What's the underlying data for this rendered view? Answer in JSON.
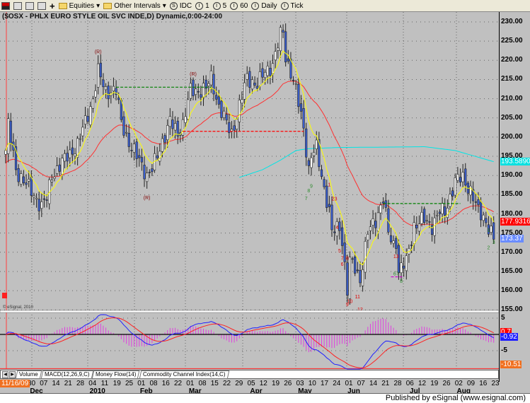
{
  "toolbar": {
    "items": [
      "Equities",
      "Other Intervals",
      "IDC",
      "1",
      "5",
      "60",
      "Daily",
      "Tick"
    ]
  },
  "chart_title": "($OSX - PHLX EURO STYLE OIL SVC INDE,D) Dynamic,0:00-24:00",
  "copyright": "© eSignal, 2010",
  "tabs": [
    "Volume",
    "MACD(12,26,9,C)",
    "Money Flow(14)",
    "Commodity Channel Index(14,C)"
  ],
  "start_date": "11/16/09",
  "status": "Published by eSignal (www.esignal.com)",
  "chart_data": {
    "type": "candlestick",
    "symbol": "$OSX",
    "ylim": [
      155,
      230
    ],
    "yticks": [
      "230.00",
      "225.00",
      "220.00",
      "215.00",
      "210.00",
      "205.00",
      "200.00",
      "195.00",
      "190.00",
      "185.00",
      "180.00",
      "175.00",
      "170.00",
      "165.00",
      "160.00",
      "155.00"
    ],
    "bars": 191,
    "close_waypoints": [
      [
        0,
        196.5
      ],
      [
        1,
        203
      ],
      [
        4,
        191.5
      ],
      [
        14,
        182
      ],
      [
        16,
        184
      ],
      [
        18,
        190
      ],
      [
        24,
        195
      ],
      [
        28,
        198
      ],
      [
        34,
        210
      ],
      [
        36,
        217
      ],
      [
        39,
        212
      ],
      [
        43,
        212
      ],
      [
        45,
        204
      ],
      [
        49,
        197
      ],
      [
        53,
        193
      ],
      [
        55,
        190
      ],
      [
        57,
        191.5
      ],
      [
        61,
        199
      ],
      [
        64,
        204
      ],
      [
        67,
        201
      ],
      [
        69,
        203.5
      ],
      [
        72,
        212
      ],
      [
        78,
        212.5
      ],
      [
        80,
        215.5
      ],
      [
        83,
        208
      ],
      [
        86,
        203.5
      ],
      [
        88,
        201
      ],
      [
        91,
        208
      ],
      [
        94,
        215.5
      ],
      [
        98,
        213.6
      ],
      [
        101,
        217
      ],
      [
        104,
        219
      ],
      [
        107,
        226.5
      ],
      [
        108,
        227.5
      ],
      [
        109,
        221
      ],
      [
        111,
        217
      ],
      [
        113,
        212
      ],
      [
        116,
        202.5
      ],
      [
        118,
        191.5
      ],
      [
        119,
        195
      ],
      [
        121,
        197
      ],
      [
        123,
        190
      ],
      [
        126,
        180.5
      ],
      [
        127,
        175
      ],
      [
        130,
        177
      ],
      [
        131,
        173
      ],
      [
        133,
        160
      ],
      [
        134,
        167.5
      ],
      [
        136,
        166
      ],
      [
        138,
        163
      ],
      [
        141,
        175
      ],
      [
        144,
        178.5
      ],
      [
        147,
        184
      ],
      [
        149,
        175
      ],
      [
        151,
        172
      ],
      [
        152,
        173
      ],
      [
        153,
        165
      ],
      [
        156,
        167.5
      ],
      [
        159,
        177
      ],
      [
        163,
        178.5
      ],
      [
        166,
        177
      ],
      [
        169,
        180.5
      ],
      [
        171,
        180.5
      ],
      [
        175,
        188.5
      ],
      [
        178,
        189.5
      ],
      [
        181,
        186
      ],
      [
        184,
        180.5
      ],
      [
        186,
        179.5
      ],
      [
        189,
        175
      ],
      [
        190,
        173.37
      ]
    ],
    "ma_long_waypoints": [
      [
        91,
        189.5
      ],
      [
        100,
        191.5
      ],
      [
        107,
        194
      ],
      [
        113,
        196.5
      ],
      [
        118,
        197
      ],
      [
        130,
        197.3
      ],
      [
        150,
        197.4
      ],
      [
        163,
        197.5
      ],
      [
        175,
        196.5
      ],
      [
        190,
        193.6
      ]
    ],
    "hlines": [
      {
        "price": 213,
        "from": 43,
        "to": 80,
        "color": "#008000"
      },
      {
        "price": 201.5,
        "from": 69,
        "to": 116,
        "color": "#ff0000"
      },
      {
        "price": 182.7,
        "from": 147,
        "to": 177,
        "color": "#008000"
      },
      {
        "price": 163.6,
        "from": 150,
        "to": 155,
        "color": "#cc00cc"
      }
    ],
    "annotations": [
      {
        "bar": 36,
        "price": 221.8,
        "text": "(R)",
        "color": "#800000"
      },
      {
        "bar": 73,
        "price": 216,
        "text": "(R)",
        "color": "#800000"
      },
      {
        "bar": 55,
        "price": 183.8,
        "text": "(R)",
        "color": "#800000"
      },
      {
        "bar": 117,
        "price": 183.6,
        "text": "7",
        "color": "#2e8b2e"
      },
      {
        "bar": 118,
        "price": 185.6,
        "text": "8",
        "color": "#2e8b2e"
      },
      {
        "bar": 119,
        "price": 186.8,
        "text": "9",
        "color": "#2e8b2e"
      },
      {
        "bar": 126,
        "price": 187.2,
        "text": "1",
        "color": "#e00000"
      },
      {
        "bar": 128,
        "price": 183.5,
        "text": "23",
        "color": "#e00000"
      },
      {
        "bar": 129,
        "price": 176,
        "text": "4",
        "color": "#e00000"
      },
      {
        "bar": 130,
        "price": 170,
        "text": "5",
        "color": "#e00000"
      },
      {
        "bar": 131,
        "price": 168,
        "text": "7",
        "color": "#e00000"
      },
      {
        "bar": 131,
        "price": 166.5,
        "text": "6",
        "color": "#e00000"
      },
      {
        "bar": 133,
        "price": 168,
        "text": "8",
        "color": "#e00000"
      },
      {
        "bar": 133,
        "price": 156,
        "text": "9",
        "color": "#e00000"
      },
      {
        "bar": 134,
        "price": 156.8,
        "text": "10",
        "color": "#e00000"
      },
      {
        "bar": 137,
        "price": 158,
        "text": "11",
        "color": "#e00000"
      },
      {
        "bar": 138,
        "price": 154.7,
        "text": "12",
        "color": "#e00000"
      },
      {
        "bar": 152,
        "price": 168.5,
        "text": "13",
        "color": "#e00000"
      },
      {
        "bar": 152,
        "price": 164,
        "text": "67",
        "color": "#2e8b2e"
      },
      {
        "bar": 154,
        "price": 162,
        "text": "8",
        "color": "#2e8b2e"
      },
      {
        "bar": 188,
        "price": 175.3,
        "text": "1",
        "color": "#2e8b2e"
      },
      {
        "bar": 188,
        "price": 170.8,
        "text": "2",
        "color": "#2e8b2e"
      },
      {
        "bar": 190,
        "price": 172.2,
        "text": "3",
        "color": "#2e8b2e"
      }
    ],
    "price_tags": [
      {
        "text": "193.58905",
        "price": 193.6,
        "bg": "#00e0e0",
        "fg": "#fff"
      },
      {
        "text": "177.9316",
        "price": 177.9,
        "bg": "#ff0000",
        "fg": "#fff"
      },
      {
        "text": "173.37",
        "price": 173.4,
        "bg": "#6a8cff",
        "fg": "#fff"
      }
    ],
    "macd": {
      "params": "12,26,9",
      "ylim": [
        -10.51,
        6
      ],
      "yticks": [
        "5",
        "-5"
      ],
      "tags": [
        {
          "text": "0.7",
          "value": 0.7,
          "bg": "#ff0000"
        },
        {
          "text": "-0.92",
          "value": -0.92,
          "bg": "#2020ff"
        },
        {
          "text": "-10.51",
          "value": -10.51,
          "bg": "#f07020"
        }
      ]
    },
    "x_week_labels": [
      "30",
      "07",
      "14",
      "21",
      "28",
      "04",
      "11",
      "19",
      "25",
      "01",
      "08",
      "16",
      "22",
      "01",
      "08",
      "15",
      "22",
      "29",
      "05",
      "12",
      "19",
      "26",
      "03",
      "10",
      "17",
      "24",
      "01",
      "07",
      "14",
      "21",
      "28",
      "06",
      "12",
      "19",
      "26",
      "02",
      "09",
      "16",
      "23"
    ],
    "x_month_labels": [
      {
        "label": "Dec",
        "week": 0
      },
      {
        "label": "2010",
        "week": 5
      },
      {
        "label": "Feb",
        "week": 9
      },
      {
        "label": "Mar",
        "week": 13
      },
      {
        "label": "Apr",
        "week": 18
      },
      {
        "label": "May",
        "week": 22
      },
      {
        "label": "Jun",
        "week": 26
      },
      {
        "label": "Jul",
        "week": 31
      },
      {
        "label": "Aug",
        "week": 35
      }
    ],
    "colors": {
      "up": "#ffffff",
      "down": "#3a5fd0",
      "ma_fast": "#ffff00",
      "ma_mid": "#ff3030",
      "ma_long": "#00e5e5",
      "macd": "#2020ff",
      "signal": "#ff2020",
      "hist": "#e040e0"
    }
  }
}
